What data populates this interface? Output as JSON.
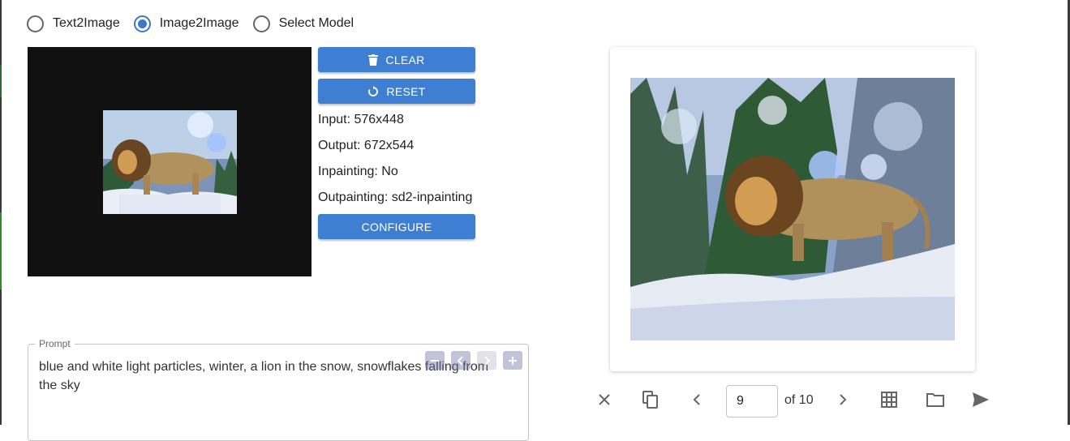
{
  "modes": {
    "options": [
      {
        "label": "Text2Image",
        "checked": false
      },
      {
        "label": "Image2Image",
        "checked": true
      },
      {
        "label": "Select Model",
        "checked": false
      }
    ]
  },
  "actions": {
    "clear_label": "CLEAR",
    "reset_label": "RESET",
    "configure_label": "CONFIGURE"
  },
  "info": {
    "input": "Input: 576x448",
    "output": "Output: 672x544",
    "inpainting": "Inpainting: No",
    "outpainting": "Outpainting: sd2-inpainting"
  },
  "prompt": {
    "legend": "Prompt",
    "text": "blue and white light particles, winter, a lion in the snow, snowflakes falling from the sky"
  },
  "pager": {
    "current": "9",
    "of_label": "of 10"
  },
  "colors": {
    "accent": "#3f7fd2",
    "radio_checked": "#3b78c9",
    "canvas_bg": "#111111"
  },
  "icons": {
    "clear": "trash-icon",
    "reset": "reset-icon",
    "toolbar": [
      "close-icon",
      "copy-icon",
      "chevron-left-icon",
      "chevron-right-icon",
      "grid-icon",
      "folder-icon",
      "send-icon"
    ],
    "prompt_tools": [
      "minus-icon",
      "chevron-left-icon",
      "chevron-right-icon",
      "plus-icon"
    ]
  }
}
